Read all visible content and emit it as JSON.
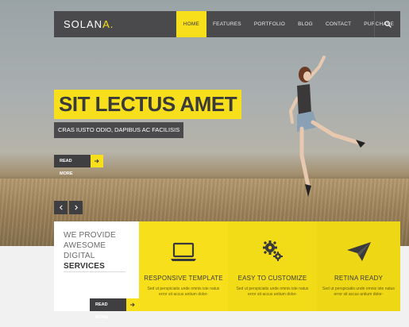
{
  "brand": {
    "name_main": "SOLAN",
    "name_accent": "A."
  },
  "nav": {
    "items": [
      {
        "label": "HOME",
        "active": true
      },
      {
        "label": "FEATURES",
        "active": false
      },
      {
        "label": "PORTFOLIO",
        "active": false
      },
      {
        "label": "BLOG",
        "active": false
      },
      {
        "label": "CONTACT",
        "active": false
      },
      {
        "label": "PURCHASE",
        "active": false
      }
    ],
    "search_icon": "search-icon"
  },
  "hero": {
    "title": "SIT LECTUS AMET",
    "subtitle": "CRAS IUSTO ODIO, DAPIBUS AC FACILISIS",
    "cta_label": "READ MORE"
  },
  "intro": {
    "lines": [
      "WE PROVIDE",
      "AWESOME DIGITAL",
      "SERVICES"
    ],
    "cta_label": "READ MORE"
  },
  "features": [
    {
      "icon": "laptop-icon",
      "title": "RESPONSIVE TEMPLATE",
      "desc": "Sed ut perspiciatis unde omnis iste natus error sit accus antium dolor-"
    },
    {
      "icon": "gears-icon",
      "title": "EASY TO CUSTOMIZE",
      "desc": "Sed ut perspiciatis unde omnis iste natus error sit accus antium dolor-"
    },
    {
      "icon": "paper-plane-icon",
      "title": "RETINA READY",
      "desc": "Sed ut perspiciatis unde omnis iste natus error sit accus antium dolor-"
    }
  ],
  "colors": {
    "accent": "#f7e01b",
    "dark": "#4a4a4d"
  }
}
